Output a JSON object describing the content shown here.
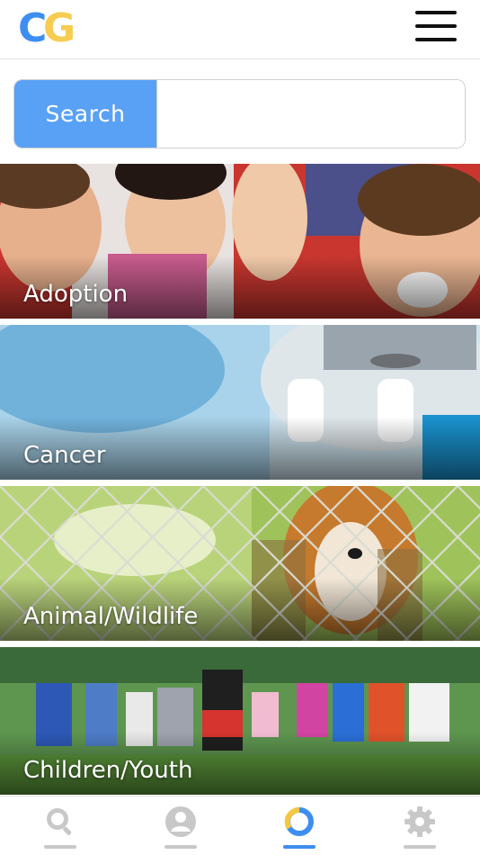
{
  "app": {
    "logo_text": "CG",
    "colors": {
      "logo_c": "#3d8ef0",
      "logo_g": "#f5c842",
      "accent": "#59a1f5",
      "nav_active": "#3d8ef0",
      "nav_inactive": "#c8c8c8"
    }
  },
  "header": {
    "menu_icon": "hamburger-menu-icon"
  },
  "search": {
    "button_label": "Search",
    "input_value": "",
    "placeholder": ""
  },
  "categories": [
    {
      "label": "Adoption"
    },
    {
      "label": "Cancer"
    },
    {
      "label": "Animal/Wildlife"
    },
    {
      "label": "Children/Youth"
    }
  ],
  "bottom_nav": {
    "items": [
      {
        "icon": "search-icon",
        "active": false
      },
      {
        "icon": "profile-icon",
        "active": false
      },
      {
        "icon": "ring-icon",
        "active": true
      },
      {
        "icon": "gear-icon",
        "active": false
      }
    ]
  }
}
